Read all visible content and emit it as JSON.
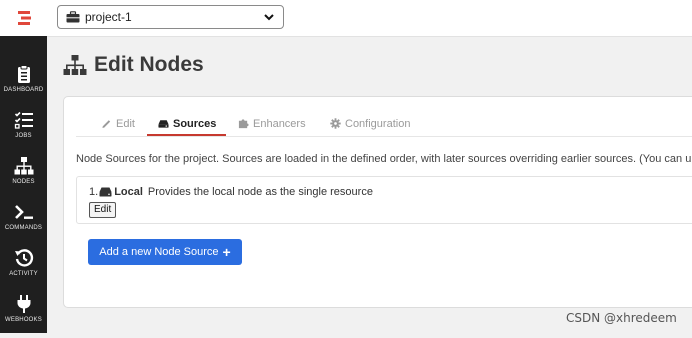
{
  "topbar": {
    "project_select": {
      "value": "project-1",
      "icon": "briefcase-icon",
      "caret": "chevron-down-icon"
    },
    "logo": "rundeck-logo"
  },
  "sidebar": {
    "items": [
      {
        "label": "DASHBOARD",
        "icon": "clipboard-icon"
      },
      {
        "label": "JOBS",
        "icon": "checklist-icon"
      },
      {
        "label": "NODES",
        "icon": "sitemap-icon"
      },
      {
        "label": "COMMANDS",
        "icon": "terminal-icon"
      },
      {
        "label": "ACTIVITY",
        "icon": "history-icon"
      },
      {
        "label": "WEBHOOKS",
        "icon": "plug-icon"
      }
    ]
  },
  "page": {
    "title": "Edit Nodes",
    "title_icon": "sitemap-icon"
  },
  "tabs": [
    {
      "label": "Edit",
      "icon": "pencil-icon",
      "active": false
    },
    {
      "label": "Sources",
      "icon": "hdd-icon",
      "active": true
    },
    {
      "label": "Enhancers",
      "icon": "puzzle-icon",
      "active": false
    },
    {
      "label": "Configuration",
      "icon": "cog-icon",
      "active": false
    }
  ],
  "description": "Node Sources for the project. Sources are loaded in the defined order, with later sources overriding earlier sources. (You can u",
  "sources": [
    {
      "index": "1.",
      "name": "Local",
      "description": "Provides the local node as the single resource",
      "edit_label": "Edit"
    }
  ],
  "add_button": {
    "label": "Add a new Node Source",
    "icon": "plus-icon"
  },
  "watermark": "CSDN @xhredeem",
  "colors": {
    "sidebar_bg": "#1f1f1f",
    "accent_red": "#c6392f",
    "primary_blue": "#2b6de0"
  }
}
